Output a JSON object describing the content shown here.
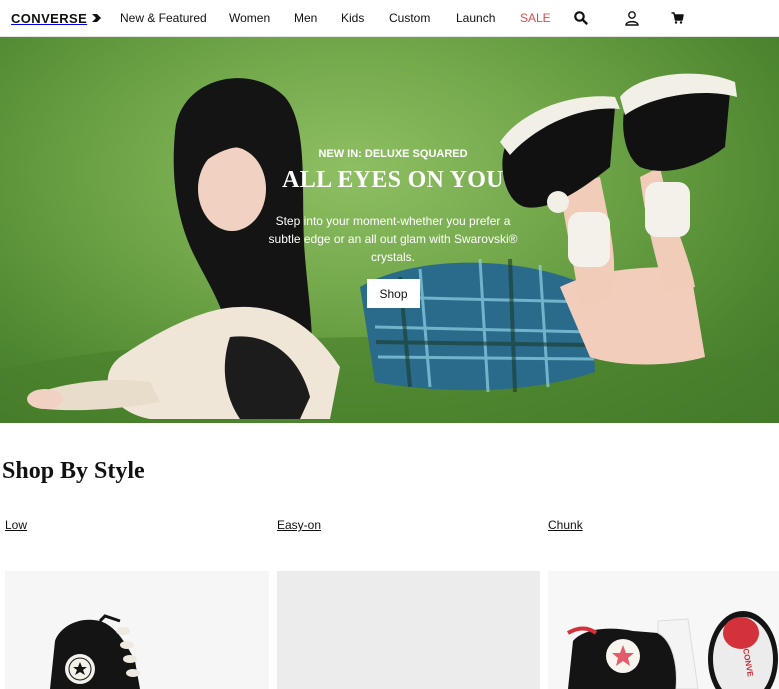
{
  "brand": {
    "name": "CONVERSE"
  },
  "nav": {
    "items": [
      "New & Featured",
      "Women",
      "Men",
      "Kids",
      "Custom",
      "Launch",
      "SALE"
    ],
    "sale_color": "#e04a4a"
  },
  "header_icons": [
    "search-icon",
    "account-icon",
    "cart-icon"
  ],
  "hero": {
    "eyebrow": "NEW IN: DELUXE SQUARED",
    "title": "ALL EYES ON YOU",
    "description": "Step into your moment-whether you prefer a subtle edge or an all out glam with Swarovski® crystals.",
    "cta_label": "Shop",
    "background_color": "#6ea447"
  },
  "shop_by_style": {
    "title": "Shop By Style",
    "categories": [
      {
        "label": "Low"
      },
      {
        "label": "Easy-on"
      },
      {
        "label": "Chunk"
      }
    ]
  }
}
